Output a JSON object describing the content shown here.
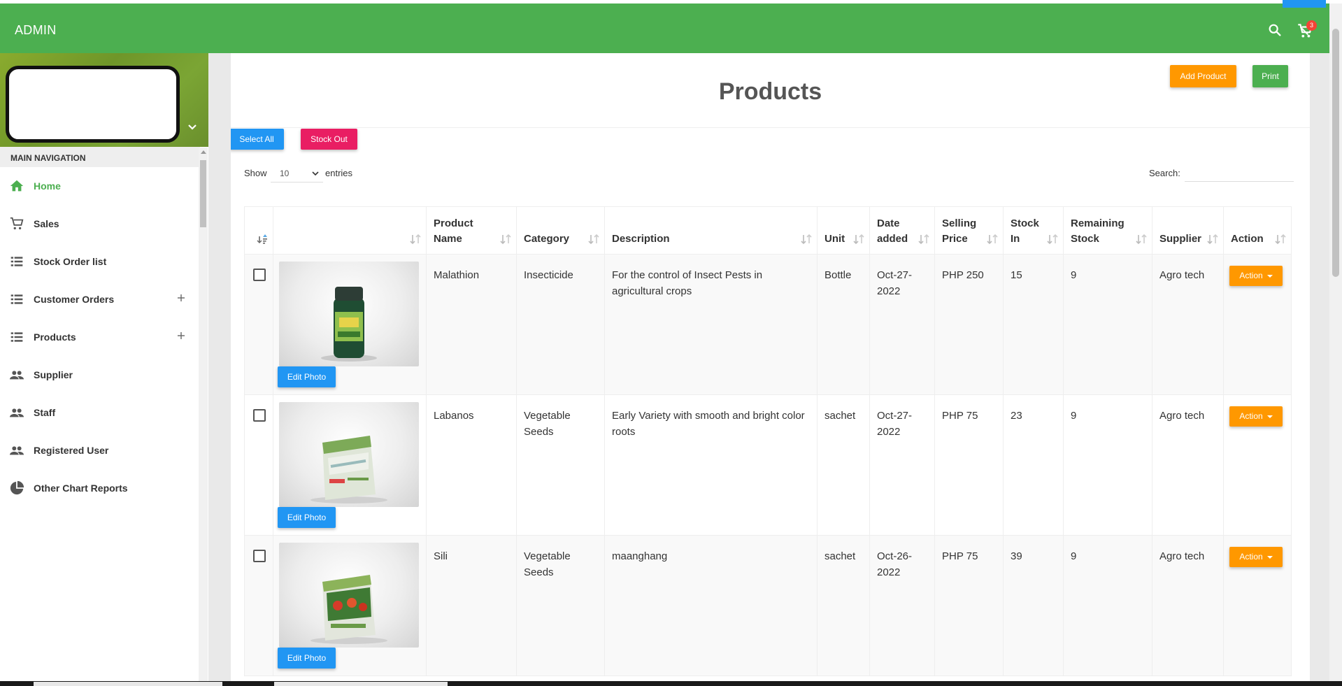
{
  "header": {
    "brand": "ADMIN",
    "cart_count": "3",
    "icons": [
      "search-icon",
      "cart-icon"
    ]
  },
  "sidebar": {
    "nav_header": "MAIN NAVIGATION",
    "items": [
      {
        "label": "Home",
        "icon": "home-icon",
        "active": true
      },
      {
        "label": "Sales",
        "icon": "cart-icon"
      },
      {
        "label": "Stock Order list",
        "icon": "list-icon"
      },
      {
        "label": "Customer Orders",
        "icon": "list-icon",
        "expandable": true
      },
      {
        "label": "Products",
        "icon": "list-icon",
        "expandable": true
      },
      {
        "label": "Supplier",
        "icon": "people-icon"
      },
      {
        "label": "Staff",
        "icon": "people-icon"
      },
      {
        "label": "Registered User",
        "icon": "people-icon"
      },
      {
        "label": "Other Chart Reports",
        "icon": "pie-chart-icon"
      }
    ]
  },
  "main": {
    "title": "Products",
    "add_label": "Add Product",
    "print_label": "Print",
    "select_all_label": "Select All",
    "stock_out_label": "Stock Out",
    "show_label": "Show",
    "entries_value": "10",
    "entries_label": "entries",
    "search_label": "Search:",
    "search_value": ""
  },
  "table": {
    "columns": [
      "",
      "",
      "Product Name",
      "Category",
      "Description",
      "Unit",
      "Date added",
      "Selling Price",
      "Stock In",
      "Remaining Stock",
      "Supplier",
      "Action"
    ],
    "edit_photo_label": "Edit Photo",
    "action_label": "Action",
    "rows": [
      {
        "name": "Malathion",
        "category": "Insecticide",
        "description": "For the control of Insect Pests in agricultural crops",
        "unit": "Bottle",
        "date": "Oct-27-2022",
        "price": "PHP 250",
        "stock_in": "15",
        "remaining": "9",
        "supplier": "Agro tech"
      },
      {
        "name": "Labanos",
        "category": "Vegetable Seeds",
        "description": "Early Variety with smooth and bright color roots",
        "unit": "sachet",
        "date": "Oct-27-2022",
        "price": "PHP 75",
        "stock_in": "23",
        "remaining": "9",
        "supplier": "Agro tech"
      },
      {
        "name": "Sili",
        "category": "Vegetable Seeds",
        "description": "maanghang",
        "unit": "sachet",
        "date": "Oct-26-2022",
        "price": "PHP 75",
        "stock_in": "39",
        "remaining": "9",
        "supplier": "Agro tech"
      }
    ]
  },
  "colors": {
    "primary": "#4caf50",
    "orange": "#ff9800",
    "blue": "#2196f3",
    "pink": "#e91e63",
    "badge": "#f44336"
  }
}
